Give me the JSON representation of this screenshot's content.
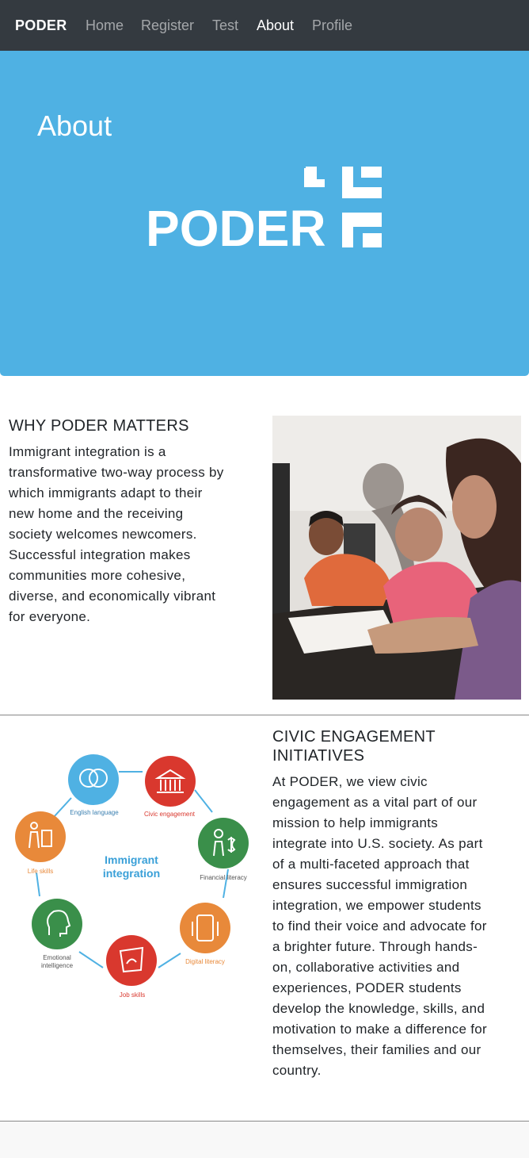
{
  "nav": {
    "brand": "PODER",
    "items": [
      {
        "label": "Home",
        "active": false
      },
      {
        "label": "Register",
        "active": false
      },
      {
        "label": "Test",
        "active": false
      },
      {
        "label": "About",
        "active": true
      },
      {
        "label": "Profile",
        "active": false
      }
    ]
  },
  "hero": {
    "title": "About",
    "logo_text": "PODER",
    "background": "#4fb1e3"
  },
  "why": {
    "title": "WHY PODER MATTERS",
    "lines": [
      "Immigrant integration is a",
      "transformative two-way process by",
      "which immigrants adapt to their",
      "new home and the receiving",
      "society welcomes newcomers.",
      "Successful integration makes",
      "communities more cohesive,",
      "diverse, and economically vibrant",
      "for everyone."
    ]
  },
  "civic": {
    "title_lines": [
      "CIVIC ENGAGEMENT",
      "INITIATIVES"
    ],
    "lines": [
      "At PODER, we view civic",
      "engagement as a vital part of our",
      "mission to help immigrants",
      "integrate into U.S. society. As part",
      "of a multi-faceted approach that",
      "ensures successful immigration",
      "integration, we empower students",
      "to find their voice and advocate for",
      "a brighter future. Through hands-",
      "on, collaborative activities and",
      "experiences, PODER students",
      "develop the knowledge, skills, and",
      "motivation to make a difference for",
      "themselves, their families and our",
      "country."
    ]
  },
  "wheel": {
    "center_line1": "Immigrant",
    "center_line2": "integration",
    "nodes": [
      {
        "label": "English language",
        "color": "#4fb1e3",
        "icon": "speech-bubbles-icon"
      },
      {
        "label": "Civic engagement",
        "color": "#d9382e",
        "icon": "capitol-building-icon"
      },
      {
        "label": "Financial literacy",
        "color": "#3a8f4a",
        "icon": "person-dollar-icon"
      },
      {
        "label": "Digital literacy",
        "color": "#e8893a",
        "icon": "devices-icon"
      },
      {
        "label": "Job skills",
        "color": "#d9382e",
        "icon": "handshake-icon"
      },
      {
        "label": "Emotional",
        "label2": "intelligence",
        "color": "#3a8f4a",
        "icon": "head-icon"
      },
      {
        "label": "Life skills",
        "color": "#e8893a",
        "icon": "puzzle-person-icon"
      }
    ]
  }
}
